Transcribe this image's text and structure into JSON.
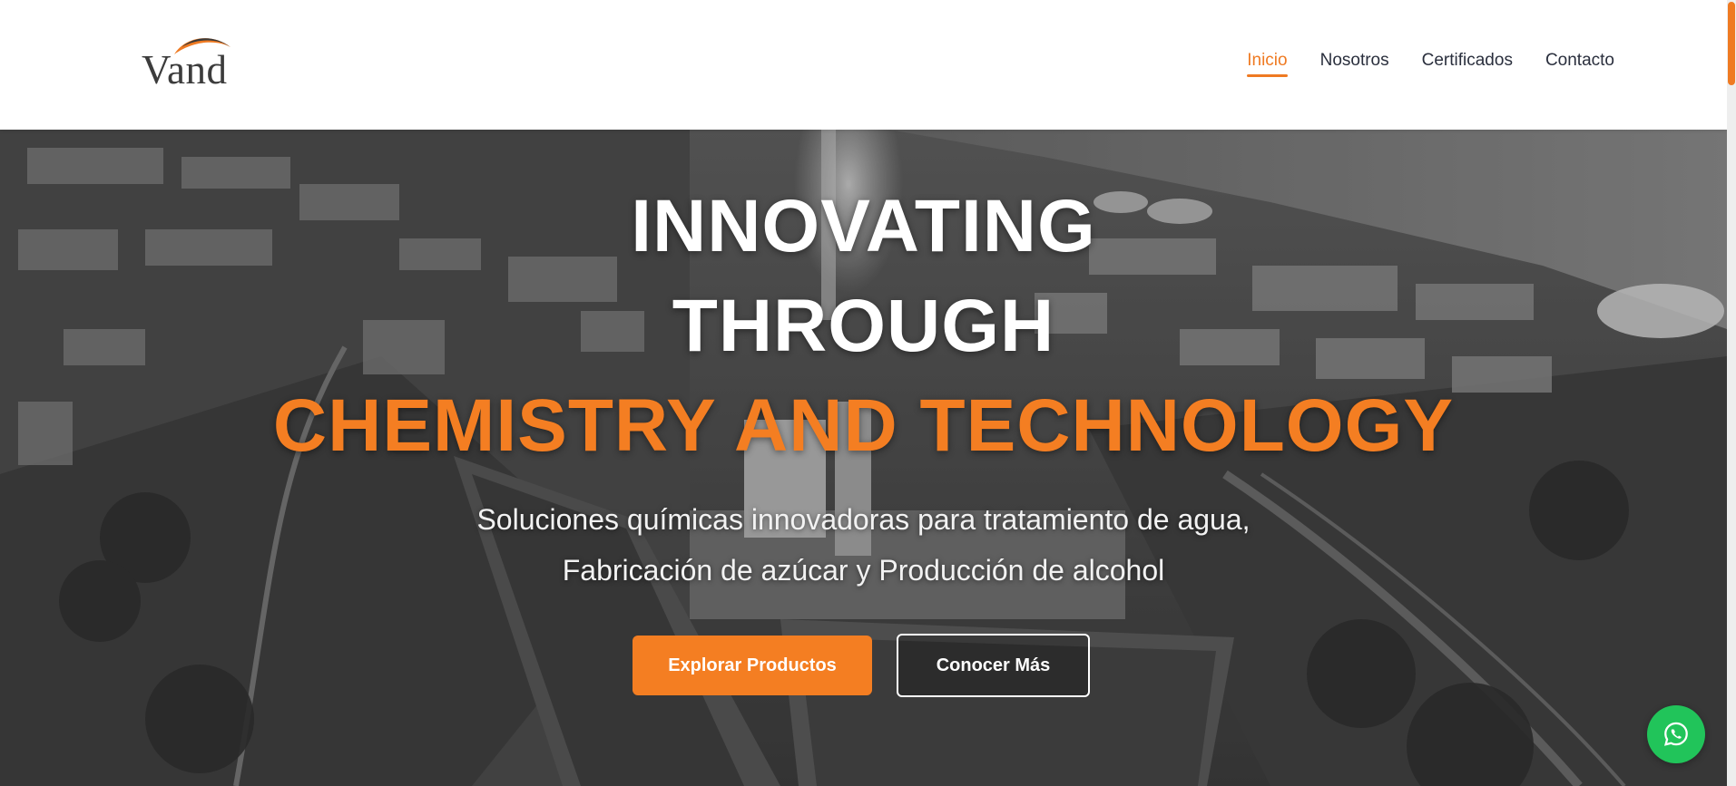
{
  "brand": {
    "name": "Vand",
    "accent_color": "#ef7a22"
  },
  "nav": {
    "items": [
      {
        "label": "Inicio",
        "active": true
      },
      {
        "label": "Nosotros",
        "active": false
      },
      {
        "label": "Certificados",
        "active": false
      },
      {
        "label": "Contacto",
        "active": false
      }
    ]
  },
  "hero": {
    "title_line1": "INNOVATING",
    "title_line2": "THROUGH",
    "title_line3": "CHEMISTRY AND TECHNOLOGY",
    "subtitle_line1": "Soluciones químicas innovadoras para tratamiento de agua,",
    "subtitle_line2": "Fabricación de azúcar y Producción de alcohol",
    "primary_button": "Explorar Productos",
    "secondary_button": "Conocer Más",
    "background": "aerial-industrial-plant-grayscale-photo"
  },
  "floating": {
    "icon": "whatsapp-icon",
    "color": "#21c45a"
  }
}
